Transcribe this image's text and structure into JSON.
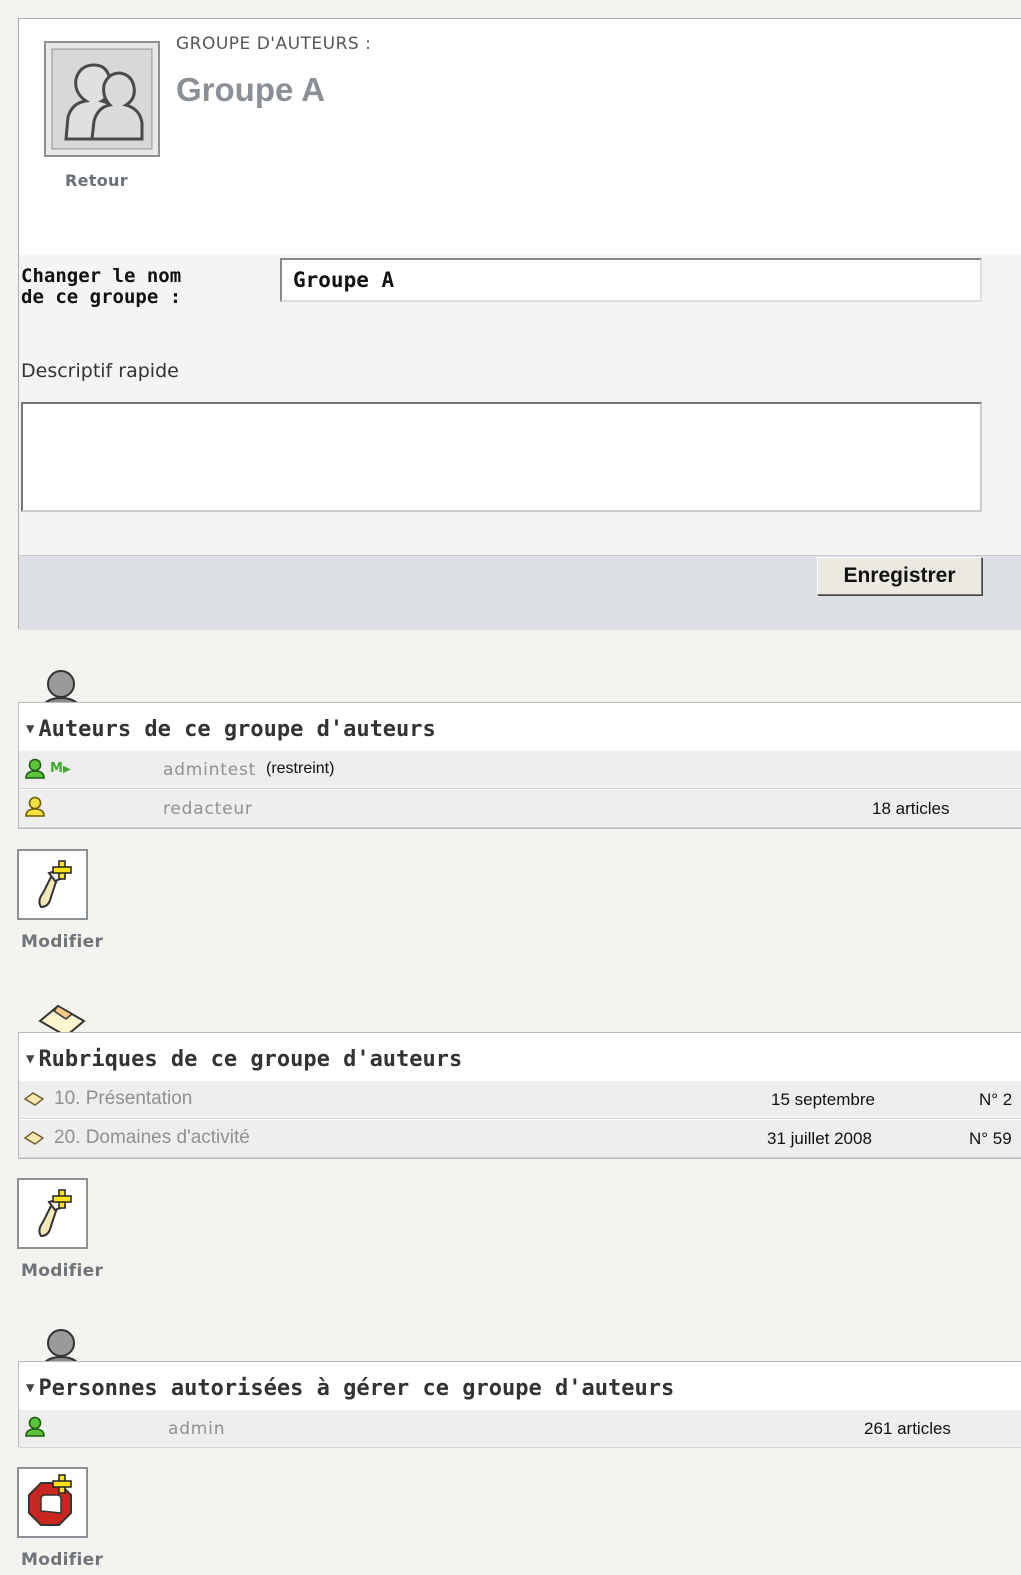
{
  "header": {
    "kicker": "GROUPE D'AUTEURS :",
    "title": "Groupe A",
    "back_label": "Retour"
  },
  "form": {
    "rename_label_line1": "Changer le nom",
    "rename_label_line2": "de ce groupe :",
    "rename_value": "Groupe A",
    "description_label": "Descriptif rapide",
    "description_value": "",
    "save_label": "Enregistrer"
  },
  "authors_section": {
    "title": "Auteurs de ce groupe d'auteurs",
    "rows": [
      {
        "name": "admintest",
        "status": "(restreint)",
        "badge": "M",
        "count": "",
        "icon": "admin-user-icon"
      },
      {
        "name": "redacteur",
        "status": "",
        "badge": "",
        "count": "18 articles",
        "icon": "redactor-user-icon"
      }
    ],
    "modify_label": "Modifier"
  },
  "rubrics_section": {
    "title": "Rubriques de ce groupe d'auteurs",
    "rows": [
      {
        "title": "10. Présentation",
        "date": "15 septembre",
        "number": "N° 2"
      },
      {
        "title": "20. Domaines d'activité",
        "date": "31 juillet 2008",
        "number": "N° 59"
      }
    ],
    "modify_label": "Modifier"
  },
  "managers_section": {
    "title": "Personnes autorisées à gérer ce groupe d'auteurs",
    "rows": [
      {
        "name": "admin",
        "count": "261 articles"
      }
    ],
    "modify_label": "Modifier"
  },
  "colors": {
    "panel_border": "#a9adb2",
    "footer_bg": "#dde1e5",
    "page_bg": "#f4f3ef",
    "label_grey": "#6e747a"
  }
}
